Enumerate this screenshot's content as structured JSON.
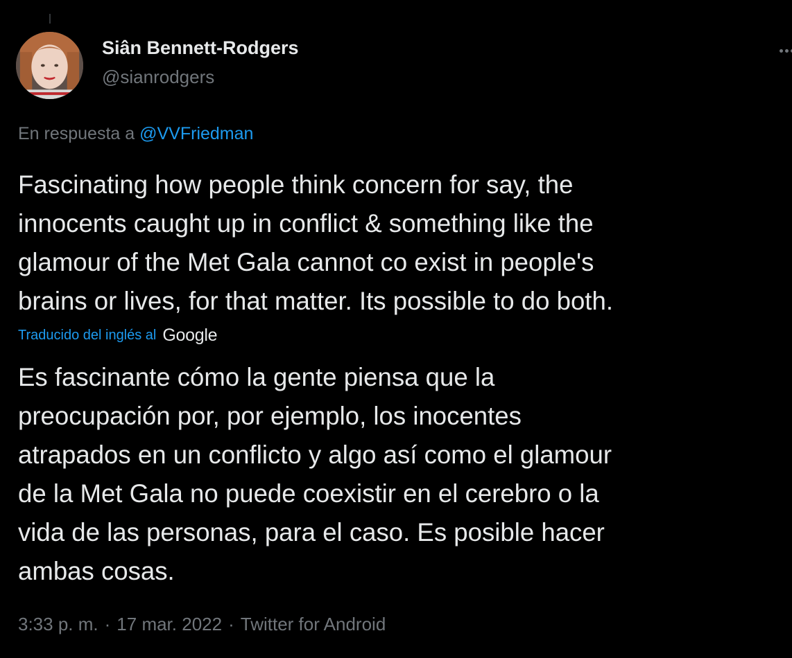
{
  "tweet": {
    "author": {
      "name": "Siân Bennett-Rodgers",
      "handle": "@sianrodgers"
    },
    "reply_to": {
      "prefix": "En respuesta a",
      "handle": "@VVFriedman"
    },
    "text": "Fascinating how people think concern for say, the\ninnocents caught up in conflict & something like the\nglamour of the Met Gala cannot co exist in people's\nbrains or lives, for that matter. Its possible to do both.",
    "translation": {
      "label": "Traducido del inglés al",
      "provider": "Google",
      "text": "Es fascinante cómo la gente piensa que la\npreocupación por, por ejemplo, los inocentes\natrapados en un conflicto y algo así como el glamour\nde la Met Gala no puede coexistir en el cerebro o la\nvida de las personas, para el caso. Es posible hacer\nambas cosas."
    },
    "meta": {
      "time": "3:33 p. m.",
      "separator": "·",
      "date": "17 mar. 2022",
      "source": "Twitter for Android"
    }
  },
  "icons": {
    "more": "more-icon"
  },
  "colors": {
    "background": "#000000",
    "primary_text": "#e7e9ea",
    "secondary_text": "#71767b",
    "link": "#1d9bf0"
  }
}
